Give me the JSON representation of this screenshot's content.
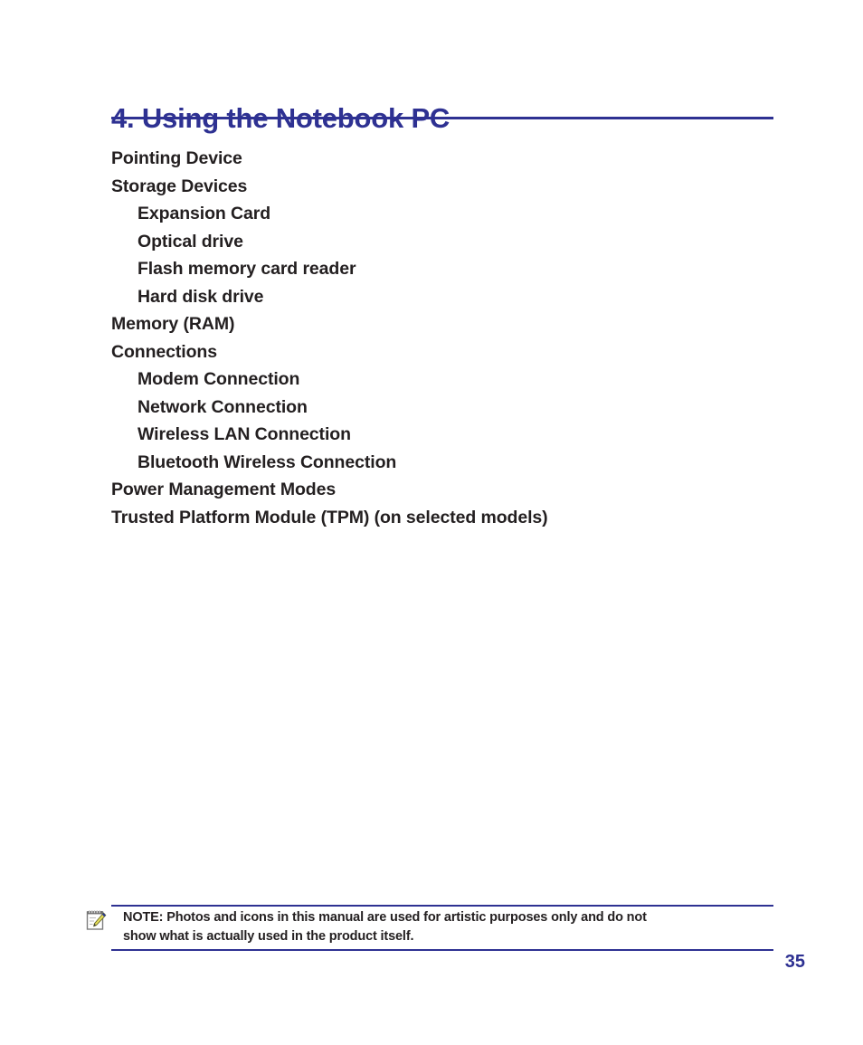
{
  "page": {
    "chapter_title": "4. Using the Notebook PC",
    "page_number": "35",
    "accent_color": "#2e3192",
    "text_color": "#231f20"
  },
  "toc": {
    "items": [
      {
        "label": "Pointing Device",
        "level": 1
      },
      {
        "label": "Storage Devices",
        "level": 1
      },
      {
        "label": "Expansion Card",
        "level": 2
      },
      {
        "label": "Optical drive",
        "level": 2
      },
      {
        "label": "Flash memory card reader",
        "level": 2
      },
      {
        "label": "Hard disk drive",
        "level": 2
      },
      {
        "label": "Memory (RAM)",
        "level": 1
      },
      {
        "label": "Connections",
        "level": 1
      },
      {
        "label": "Modem Connection",
        "level": 2
      },
      {
        "label": "Network Connection",
        "level": 2
      },
      {
        "label": "Wireless LAN Connection",
        "level": 2
      },
      {
        "label": "Bluetooth Wireless Connection",
        "level": 2
      },
      {
        "label": "Power Management Modes",
        "level": 1
      },
      {
        "label": "Trusted Platform Module (TPM) (on selected models)",
        "level": 1
      }
    ]
  },
  "note": {
    "icon": "notepad-pencil-icon",
    "line1": "NOTE: Photos and icons in this manual are used for artistic purposes only and do not",
    "line2": "show what is actually used in the product itself."
  }
}
